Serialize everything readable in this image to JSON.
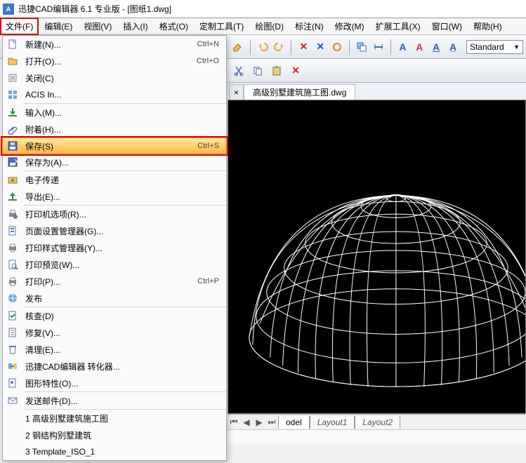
{
  "title": "迅捷CAD编辑器 6.1 专业版 - [图纸1.dwg]",
  "menubar": [
    "文件(F)",
    "编辑(E)",
    "视图(V)",
    "插入(I)",
    "格式(O)",
    "定制工具(T)",
    "绘图(D)",
    "标注(N)",
    "修改(M)",
    "扩展工具(X)",
    "窗口(W)",
    "帮助(H)"
  ],
  "file_menu": {
    "items": [
      {
        "icon": "new",
        "label": "新建(N)...",
        "shortcut": "Ctrl+N"
      },
      {
        "icon": "open",
        "label": "打开(O)...",
        "shortcut": "Ctrl+O"
      },
      {
        "icon": "close",
        "label": "关闭(C)",
        "shortcut": ""
      },
      {
        "icon": "acis",
        "label": "ACIS In...",
        "shortcut": ""
      },
      {
        "sep": true
      },
      {
        "icon": "import",
        "label": "输入(M)...",
        "shortcut": ""
      },
      {
        "icon": "attach",
        "label": "附着(H)...",
        "shortcut": ""
      },
      {
        "sep": true
      },
      {
        "icon": "save",
        "label": "保存(S)",
        "shortcut": "Ctrl+S",
        "highlight": true
      },
      {
        "icon": "saveas",
        "label": "保存为(A)...",
        "shortcut": ""
      },
      {
        "sep": true
      },
      {
        "icon": "etrans",
        "label": "电子传递",
        "shortcut": ""
      },
      {
        "icon": "export",
        "label": "导出(E)...",
        "shortcut": ""
      },
      {
        "sep": true
      },
      {
        "icon": "printopt",
        "label": "打印机选项(R)...",
        "shortcut": ""
      },
      {
        "icon": "pagesetup",
        "label": "页面设置管理器(G)...",
        "shortcut": ""
      },
      {
        "icon": "plotstyle",
        "label": "打印样式管理器(Y)...",
        "shortcut": ""
      },
      {
        "icon": "preview",
        "label": "打印预览(W)...",
        "shortcut": ""
      },
      {
        "icon": "print",
        "label": "打印(P)...",
        "shortcut": "Ctrl+P"
      },
      {
        "icon": "publish",
        "label": "发布",
        "shortcut": ""
      },
      {
        "sep": true
      },
      {
        "icon": "audit",
        "label": "核查(D)",
        "shortcut": ""
      },
      {
        "icon": "recover",
        "label": "修复(V)...",
        "shortcut": ""
      },
      {
        "icon": "purge",
        "label": "清理(E)...",
        "shortcut": ""
      },
      {
        "icon": "conv",
        "label": "迅捷CAD编辑器 转化器...",
        "shortcut": ""
      },
      {
        "icon": "props",
        "label": "图形特性(O)...",
        "shortcut": ""
      },
      {
        "sep": true
      },
      {
        "icon": "mail",
        "label": "发送邮件(D)...",
        "shortcut": ""
      },
      {
        "sep": true
      },
      {
        "icon": "",
        "label": "1 高级别墅建筑施工图",
        "shortcut": ""
      },
      {
        "icon": "",
        "label": "2 钢结构别墅建筑",
        "shortcut": ""
      },
      {
        "icon": "",
        "label": "3 Template_ISO_1",
        "shortcut": ""
      }
    ]
  },
  "toolbar_a": {
    "style_label": "Standard"
  },
  "toolbar_icons_a": [
    "redo",
    "erase",
    "blue-shape",
    "red-x",
    "blue-x",
    "orange-o",
    "copy-prop",
    "dim"
  ],
  "text_buttons": [
    "A",
    "A",
    "A",
    "A"
  ],
  "toolbar_b": [
    "cut",
    "copy",
    "delete",
    "red-x"
  ],
  "doc_tabs": {
    "close": "×",
    "tab1": "高级别墅建筑施工图.dwg"
  },
  "layout_tabs": {
    "left": "◀",
    "ll": "◀",
    "rr": "▶",
    "right": "▶",
    "model": "odel",
    "l1": "Layout1",
    "l2": "Layout2"
  }
}
